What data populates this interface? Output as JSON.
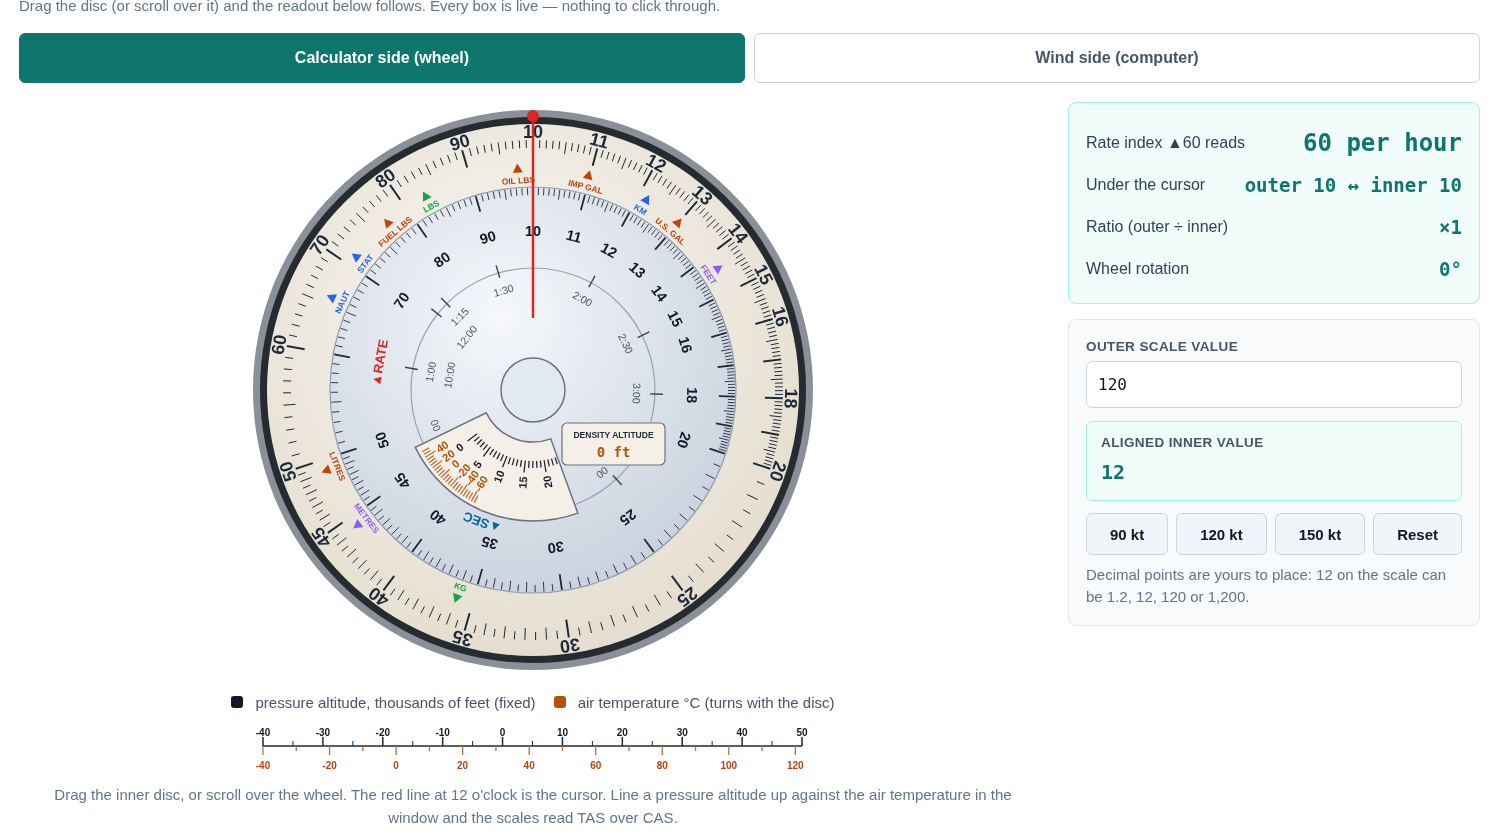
{
  "intro": "Drag the disc (or scroll over it) and the readout below follows. Every box is live — nothing to click through.",
  "tabs": [
    {
      "label": "Calculator side (wheel)",
      "selected": true
    },
    {
      "label": "Wind side (computer)",
      "selected": false
    }
  ],
  "wheel": {
    "outer_scale": [
      "10",
      "11",
      "12",
      "13",
      "14",
      "15",
      "16",
      "18",
      "20",
      "25",
      "30",
      "35",
      "40",
      "45",
      "50",
      "60",
      "70",
      "80",
      "90"
    ],
    "unit_markers": [
      {
        "label": "OIL LBS",
        "color": "#c2410c"
      },
      {
        "label": "IMP GAL",
        "color": "#c2410c"
      },
      {
        "label": "KM",
        "color": "#2563eb"
      },
      {
        "label": "U.S. GAL",
        "color": "#c2410c"
      },
      {
        "label": "FEET",
        "color": "#8b5cf6"
      },
      {
        "label": "KG",
        "color": "#16a34a"
      },
      {
        "label": "METRES",
        "color": "#8b5cf6"
      },
      {
        "label": "LITRES",
        "color": "#c2410c"
      },
      {
        "label": "NAUT",
        "color": "#2563eb"
      },
      {
        "label": "STAT",
        "color": "#2563eb"
      },
      {
        "label": "FUEL LBS",
        "color": "#c2410c"
      },
      {
        "label": "LBS",
        "color": "#16a34a"
      }
    ],
    "inner_scale": [
      "10",
      "11",
      "12",
      "13",
      "14",
      "15",
      "16",
      "18",
      "20",
      "25",
      "30",
      "35",
      "40",
      "45",
      "50",
      "70",
      "80",
      "90"
    ],
    "disc_indices": [
      {
        "label": "▲RATE",
        "color": "#dc2626"
      },
      {
        "label": "▲SEC",
        "color": "#0369a1"
      }
    ],
    "time_labels": [
      "1:00",
      "1:15",
      "1:30",
      "2:00",
      "2:30",
      "3:00",
      "00",
      "00",
      "10:00",
      "12:00"
    ],
    "density_window": {
      "altitude_marks": [
        "0",
        "5",
        "10",
        "15",
        "20"
      ],
      "temperature_marks": [
        "40",
        "20",
        "0",
        "-20",
        "-40",
        "-60"
      ],
      "readout_label": "DENSITY ALTITUDE",
      "readout_value": "0 ft"
    }
  },
  "legend": [
    {
      "label": "pressure altitude, thousands of feet (fixed)",
      "color": "#111827"
    },
    {
      "label": "air temperature °C (turns with the disc)",
      "color": "#b45309"
    }
  ],
  "temperature_ruler": {
    "top_labels": [
      "-40",
      "-30",
      "-20",
      "-10",
      "0",
      "10",
      "20",
      "30",
      "40",
      "50"
    ],
    "bottom_labels": [
      "-40",
      "-20",
      "0",
      "20",
      "40",
      "60",
      "80",
      "100",
      "120"
    ]
  },
  "caption": "Drag the inner disc, or scroll over the wheel. The red line at 12 o'clock is the cursor. Line a pressure altitude up against the air temperature in the window and the scales read TAS over CAS.",
  "readout": [
    {
      "label": "Rate index ▲60 reads",
      "value": "60 per hour"
    },
    {
      "label": "Under the cursor",
      "value": "outer 10 ↔ inner 10"
    },
    {
      "label": "Ratio (outer ÷ inner)",
      "value": "×1"
    },
    {
      "label": "Wheel rotation",
      "value": "0°"
    }
  ],
  "converter": {
    "field_label": "OUTER SCALE VALUE",
    "field_value": "120",
    "result_label": "ALIGNED INNER VALUE",
    "result_value": "12",
    "buttons": [
      "90 kt",
      "120 kt",
      "150 kt",
      "Reset"
    ],
    "note": "Decimal points are yours to place: 12 on the scale can be 1.2, 12, 120 or 1,200."
  }
}
